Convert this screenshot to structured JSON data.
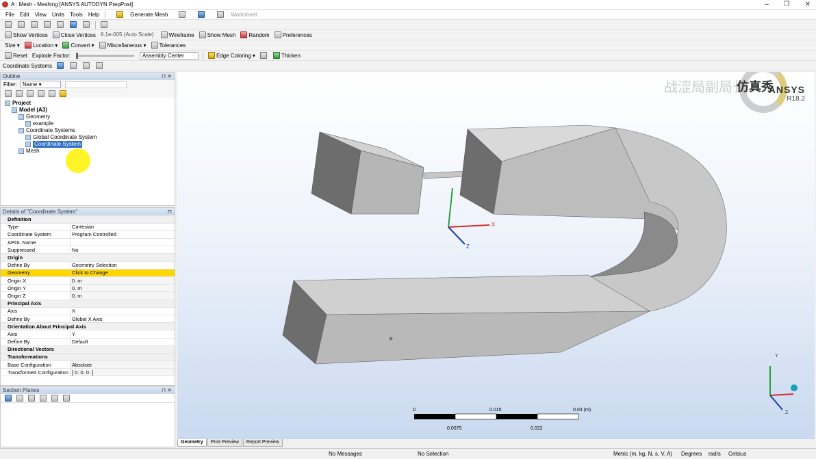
{
  "window": {
    "title": "A : Mesh - Meshing [ANSYS AUTODYN PrepPost]"
  },
  "menu": [
    "File",
    "Edit",
    "View",
    "Units",
    "Tools",
    "Help"
  ],
  "toolbar1": {
    "generate_mesh": "Generate Mesh",
    "worksheet": "Worksheet"
  },
  "toolbar2": {
    "show_vertices": "Show Vertices",
    "close_vertices": "Close Vertices",
    "scale": "9.1e-005 (Auto Scale)",
    "wireframe": "Wireframe",
    "show_mesh": "Show Mesh",
    "random": "Random",
    "preferences": "Preferences"
  },
  "toolbar3": {
    "size": "Size",
    "location": "Location",
    "convert": "Convert",
    "misc": "Miscellaneous",
    "tolerances": "Tolerances"
  },
  "toolbar4": {
    "reset": "Reset",
    "explode": "Explode Factor:",
    "assembly": "Assembly Center",
    "edge_coloring": "Edge Coloring",
    "thicken": "Thicken"
  },
  "toolbar5": {
    "coordinate_systems": "Coordinate Systems"
  },
  "outline": {
    "header": "Outline",
    "filter_label": "Filter:",
    "filter_value": "Name",
    "tree": [
      {
        "label": "Project",
        "level": 0,
        "bold": true
      },
      {
        "label": "Model (A3)",
        "level": 1,
        "bold": true
      },
      {
        "label": "Geometry",
        "level": 2
      },
      {
        "label": "example",
        "level": 3
      },
      {
        "label": "Coordinate Systems",
        "level": 2
      },
      {
        "label": "Global Coordinate System",
        "level": 3
      },
      {
        "label": "Coordinate System",
        "level": 3,
        "selected": true
      },
      {
        "label": "Mesh",
        "level": 2
      }
    ]
  },
  "details": {
    "header": "Details of \"Coordinate System\"",
    "rows": [
      {
        "group": "Definition"
      },
      {
        "k": "Type",
        "v": "Cartesian"
      },
      {
        "k": "Coordinate System",
        "v": "Program Controlled"
      },
      {
        "k": "APDL Name",
        "v": ""
      },
      {
        "k": "Suppressed",
        "v": "No"
      },
      {
        "group": "Origin"
      },
      {
        "k": "Define By",
        "v": "Geometry Selection"
      },
      {
        "k": "Geometry",
        "v": "Click to Change",
        "hl": true
      },
      {
        "k": "Origin X",
        "v": "0. m",
        "ro": true
      },
      {
        "k": "Origin Y",
        "v": "0. m",
        "ro": true
      },
      {
        "k": "Origin Z",
        "v": "0. m",
        "ro": true
      },
      {
        "group": "Principal Axis"
      },
      {
        "k": "Axis",
        "v": "X"
      },
      {
        "k": "Define By",
        "v": "Global X Axis"
      },
      {
        "group": "Orientation About Principal Axis"
      },
      {
        "k": "Axis",
        "v": "Y"
      },
      {
        "k": "Define By",
        "v": "Default"
      },
      {
        "group": "Directional Vectors"
      },
      {
        "group": "Transformations"
      },
      {
        "k": "Base Configuration",
        "v": "Absolute",
        "ro": true
      },
      {
        "k": "Transformed Configuration",
        "v": "[ 0. 0. 0. ]",
        "ro": true
      }
    ]
  },
  "section_planes": {
    "header": "Section Planes"
  },
  "viewport": {
    "brand": "ANSYS",
    "version": "R18.2",
    "watermark_cn": "仿真秀",
    "watermark_cn2": "战涩局副局长",
    "scale": {
      "top": [
        "0",
        "0.015",
        "0.03 (m)"
      ],
      "bottom": [
        "0.0075",
        "0.022"
      ]
    },
    "axes": {
      "x": "X",
      "y": "Y",
      "z": "Z"
    }
  },
  "tabs": [
    "Geometry",
    "Print Preview",
    "Report Preview"
  ],
  "status": {
    "messages": "No Messages",
    "selection": "No Selection",
    "units": "Metric (m, kg, N, s, V, A)",
    "deg": "Degrees",
    "rad": "rad/s",
    "temp": "Celsius"
  },
  "colors": {
    "selection_blue": "#2f6ec8",
    "highlight_yellow": "#ffd700",
    "body_gray": "#bcbcbc"
  }
}
